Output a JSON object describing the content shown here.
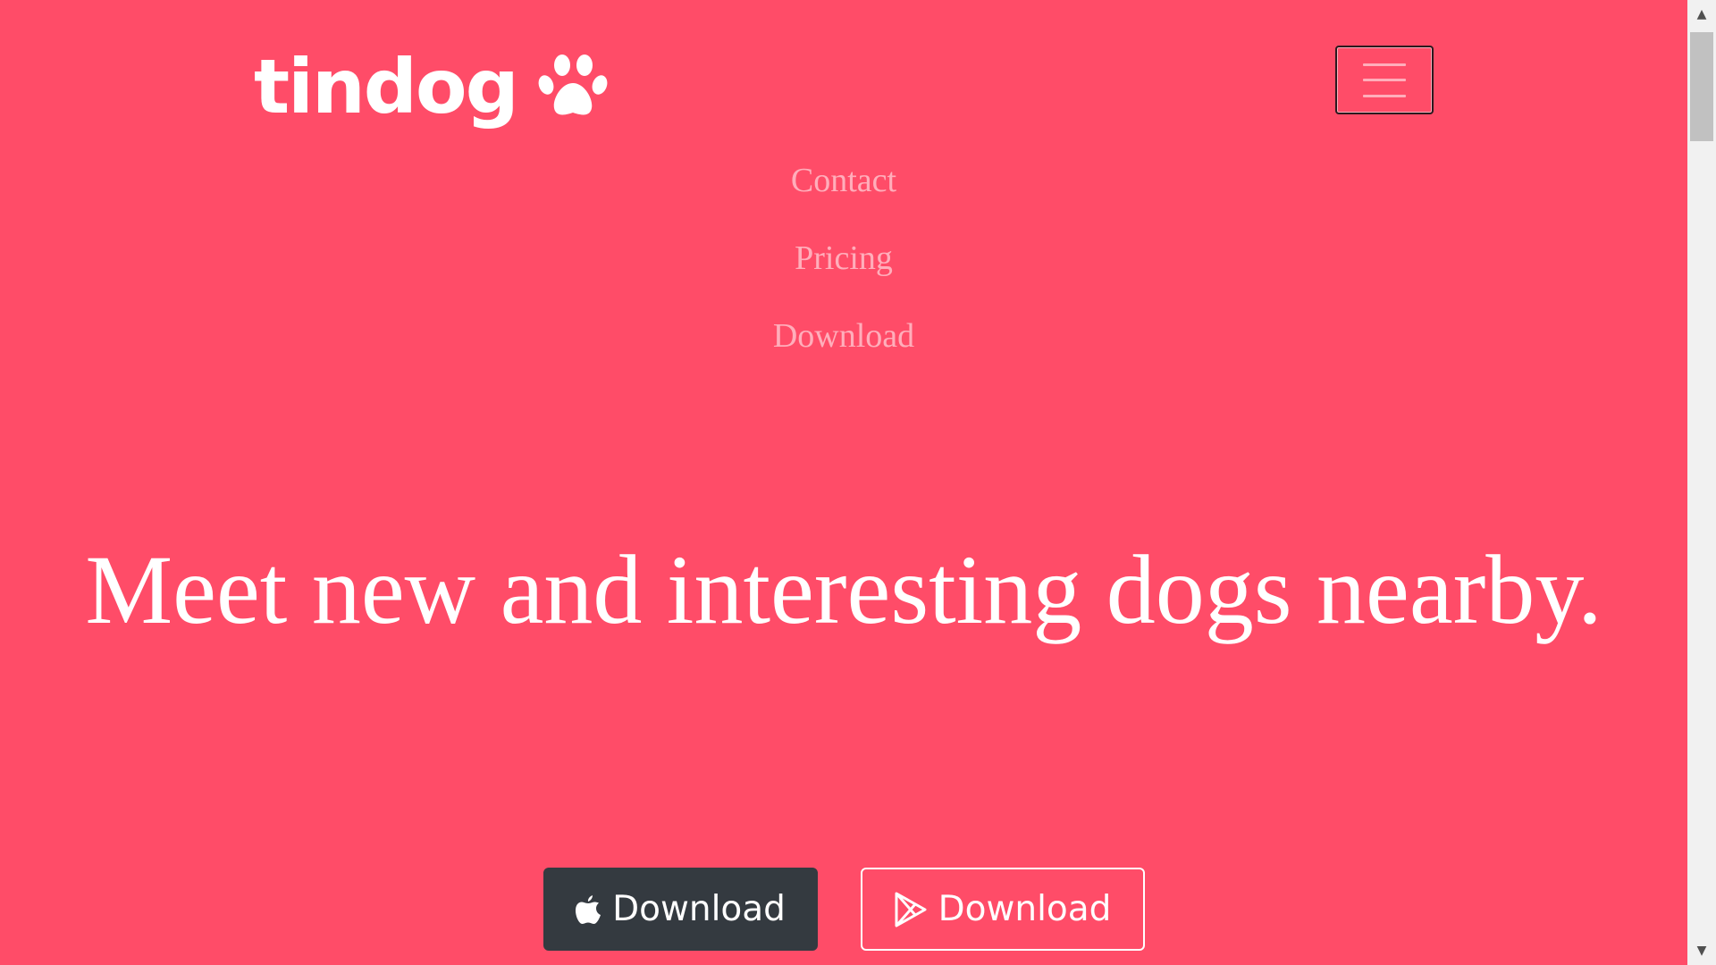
{
  "navbar": {
    "brand": "tindog",
    "brand_icon": "paw-icon",
    "toggler_icon": "hamburger-icon",
    "links": [
      {
        "label": "Contact"
      },
      {
        "label": "Pricing"
      },
      {
        "label": "Download"
      }
    ]
  },
  "hero": {
    "title": "Meet new and interesting dogs nearby.",
    "buttons": [
      {
        "label": "Download",
        "icon": "apple-icon"
      },
      {
        "label": "Download",
        "icon": "google-play-icon"
      }
    ]
  },
  "colors": {
    "background": "#ff4c68",
    "dark_button": "#343a40",
    "text": "#ffffff"
  },
  "scrollbar": {
    "up_arrow": "▲",
    "down_arrow": "▼"
  }
}
